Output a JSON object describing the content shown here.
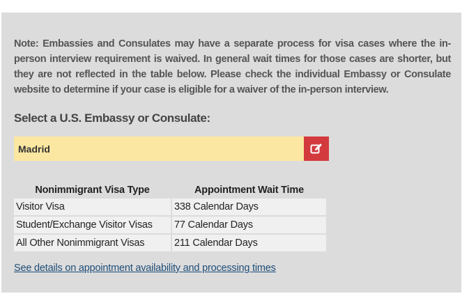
{
  "note": "Note: Embassies and Consulates may have a separate process for visa cases where the in-person interview requirement is waived.  In general wait times for those cases are shorter, but they are not reflected in the table below.  Please check the individual Embassy or Consulate website to determine if your case is eligible for a waiver of the in-person interview.",
  "select_label": "Select a U.S. Embassy or Consulate:",
  "selected_post": "Madrid",
  "edit_icon": "edit-icon",
  "colors": {
    "panel": "#dcdcdc",
    "selector_bg": "#fbe7a1",
    "edit_button": "#d33a3d",
    "link": "#1f4e79"
  },
  "table": {
    "headers": [
      "Nonimmigrant Visa Type",
      "Appointment Wait Time"
    ],
    "rows": [
      {
        "type": "Visitor Visa",
        "time": "338 Calendar Days"
      },
      {
        "type": "Student/Exchange Visitor Visas",
        "time": "77 Calendar Days"
      },
      {
        "type": "All Other Nonimmigrant Visas",
        "time": "211 Calendar Days"
      }
    ]
  },
  "details_link": "See details on appointment availability and processing times"
}
